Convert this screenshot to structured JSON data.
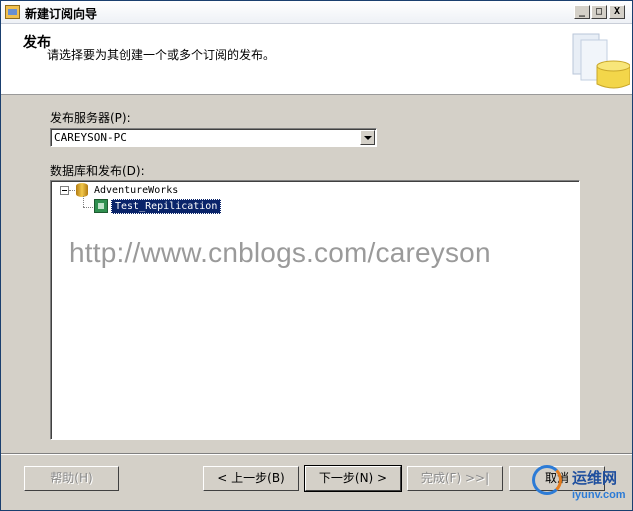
{
  "window": {
    "title": "新建订阅向导",
    "controls": {
      "minimize": "_",
      "maximize": "□",
      "close": "X"
    }
  },
  "header": {
    "title": "发布",
    "subtitle": "请选择要为其创建一个或多个订阅的发布。"
  },
  "publisher": {
    "label": "发布服务器(P):",
    "value": "CAREYSON-PC"
  },
  "tree": {
    "label": "数据库和发布(D):",
    "database": "AdventureWorks",
    "publication": "Test_Repilication",
    "expander_glyph": "−"
  },
  "watermark": "http://www.cnblogs.com/careyson",
  "buttons": {
    "help": "帮助(H)",
    "back": "< 上一步(B)",
    "next": "下一步(N) >",
    "finish": "完成(F) >>|",
    "cancel": "取消"
  },
  "corner_logo": {
    "text1": "运维网",
    "text2": "iyunv.com"
  },
  "icons": {
    "app": "wizard-icon",
    "database": "database-icon",
    "publication": "publication-icon",
    "header_art": "database-cylinder-icon",
    "dropdown": "chevron-down-icon"
  }
}
